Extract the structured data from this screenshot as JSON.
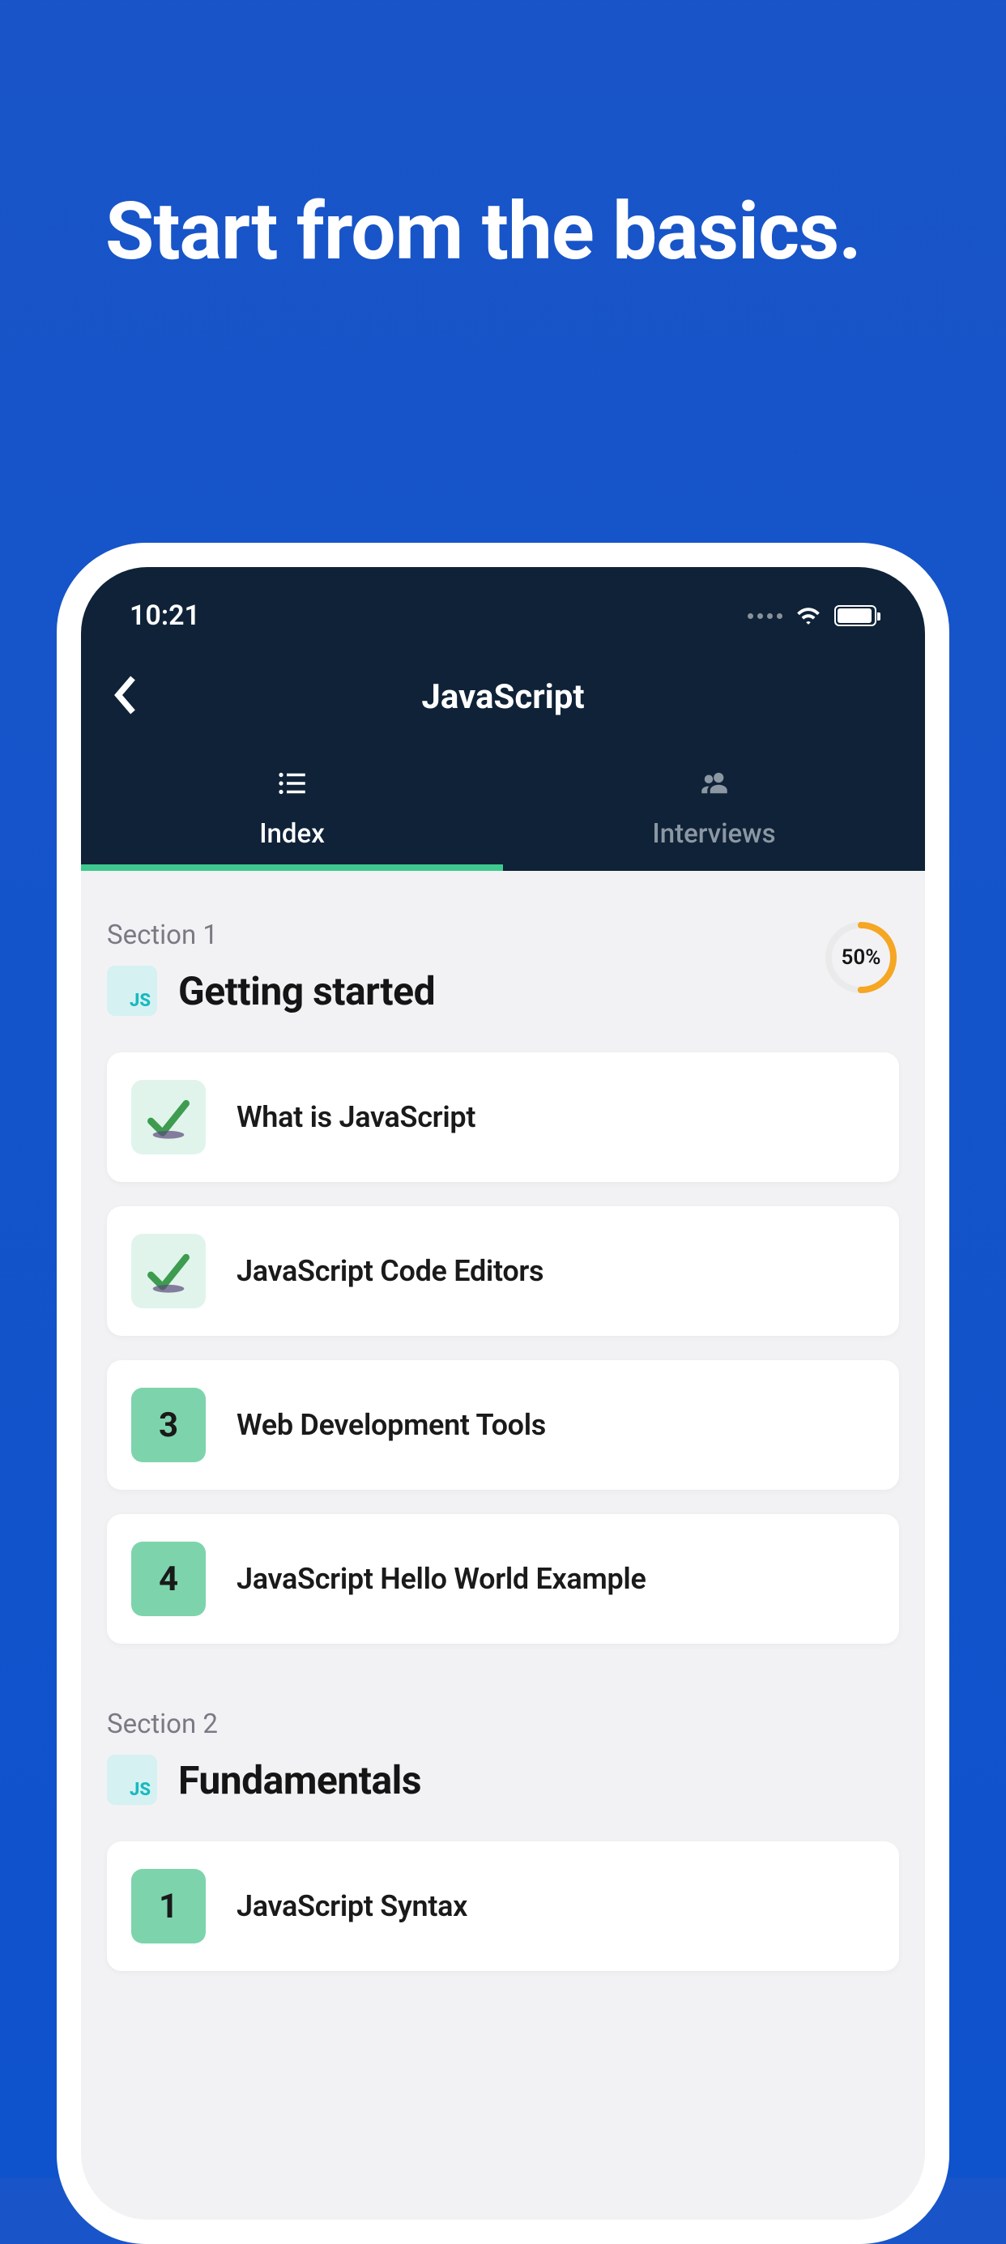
{
  "promo": {
    "headline": "Start from the basics."
  },
  "statusBar": {
    "time": "10:21"
  },
  "header": {
    "title": "JavaScript"
  },
  "tabs": [
    {
      "label": "Index",
      "active": true
    },
    {
      "label": "Interviews",
      "active": false
    }
  ],
  "sections": [
    {
      "label": "Section 1",
      "badge": "JS",
      "title": "Getting started",
      "progress": {
        "percent": 50,
        "text": "50%"
      },
      "lessons": [
        {
          "completed": true,
          "number": null,
          "title": "What is JavaScript"
        },
        {
          "completed": true,
          "number": null,
          "title": "JavaScript Code Editors"
        },
        {
          "completed": false,
          "number": "3",
          "title": "Web Development Tools"
        },
        {
          "completed": false,
          "number": "4",
          "title": "JavaScript Hello World Example"
        }
      ]
    },
    {
      "label": "Section 2",
      "badge": "JS",
      "title": "Fundamentals",
      "progress": null,
      "lessons": [
        {
          "completed": false,
          "number": "1",
          "title": "JavaScript Syntax"
        }
      ]
    }
  ]
}
